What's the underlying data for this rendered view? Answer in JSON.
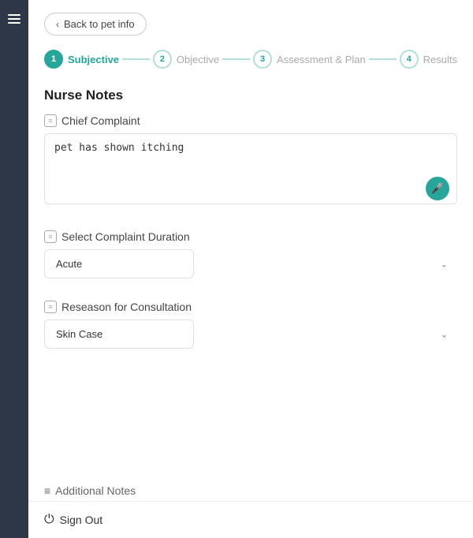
{
  "sidebar": {
    "hamburger_label": "menu"
  },
  "header": {
    "back_label": "Back to pet info"
  },
  "steps": [
    {
      "number": "1",
      "label": "Subjective",
      "active": true
    },
    {
      "number": "2",
      "label": "Objective",
      "active": false
    },
    {
      "number": "3",
      "label": "Assessment & Plan",
      "active": false
    },
    {
      "number": "4",
      "label": "Results",
      "active": false
    }
  ],
  "main": {
    "section_title": "Nurse Notes",
    "chief_complaint_label": "Chief Complaint",
    "chief_complaint_value": "pet has shown itching",
    "complaint_duration_label": "Select Complaint Duration",
    "complaint_duration_value": "Acute",
    "consultation_label": "Reseason for Consultation",
    "consultation_value": "Skin Case",
    "additional_notes_label": "Additional Notes"
  },
  "footer": {
    "signout_label": "Sign Out"
  },
  "icons": {
    "chevron_left": "‹",
    "chevron_down": "⌄",
    "mic": "🎤",
    "signout": "⏻",
    "field_icon": "≡"
  }
}
